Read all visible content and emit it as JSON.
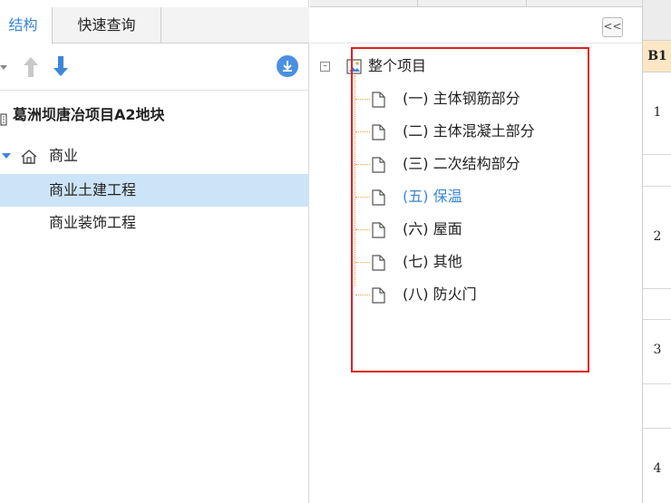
{
  "left_panel": {
    "tabs": [
      {
        "label": "结构",
        "active": true
      },
      {
        "label": "快速查询",
        "active": false
      }
    ],
    "toolbar": {
      "icons": [
        "dropdown-arrow-icon",
        "move-up-arrow-icon",
        "move-down-arrow-icon",
        "download-circle-icon"
      ]
    },
    "tree": {
      "project": "葛洲坝唐冶项目A2地块",
      "group": "商业",
      "children": [
        "商业土建工程",
        "商业装饰工程"
      ],
      "selected_index": 0
    }
  },
  "middle_panel": {
    "collapse_button_label": "<<",
    "root_label": "整个项目",
    "items": [
      {
        "label": "(一) 主体钢筋部分",
        "highlight": false
      },
      {
        "label": "(二) 主体混凝土部分",
        "highlight": false
      },
      {
        "label": "(三) 二次结构部分",
        "highlight": false
      },
      {
        "label": "(五) 保温",
        "highlight": true
      },
      {
        "label": "(六) 屋面",
        "highlight": false
      },
      {
        "label": "(七) 其他",
        "highlight": false
      },
      {
        "label": "(八) 防火门",
        "highlight": false
      }
    ]
  },
  "right_panel": {
    "column_header": "B1",
    "row_numbers": [
      "1",
      "2",
      "3",
      "4"
    ]
  },
  "colors": {
    "accent_blue": "#3a86d8",
    "selection_bg": "#cce4f7",
    "annotation_red": "#e02020",
    "guide_orange": "#e8a23d"
  }
}
